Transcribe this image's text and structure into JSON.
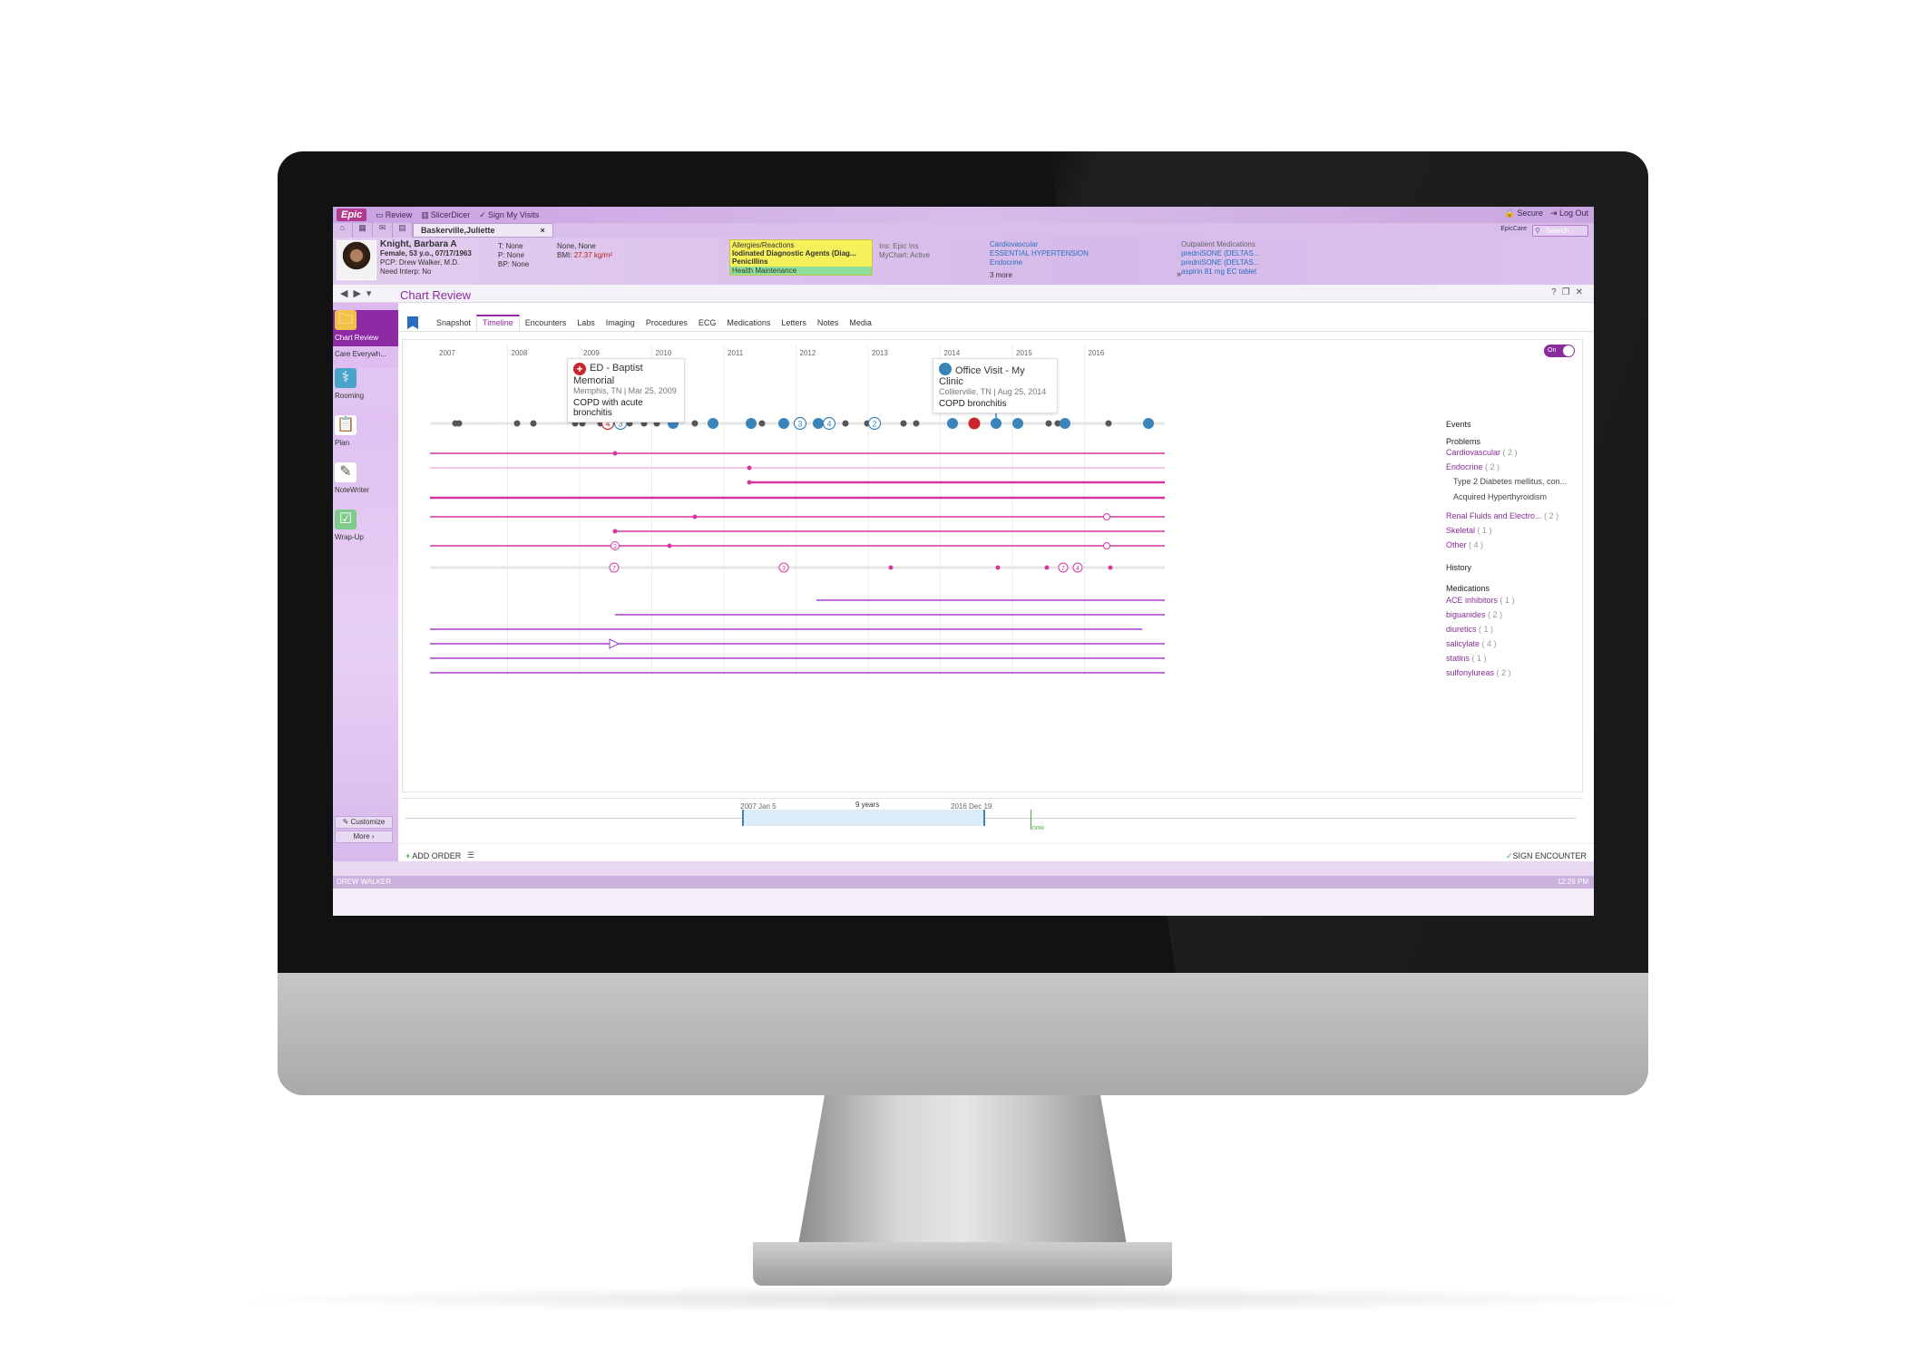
{
  "topbar": {
    "logo": "Epic",
    "items": [
      "Review",
      "SlicerDicer",
      "Sign My Visits"
    ],
    "right": [
      "Secure",
      "Log Out"
    ],
    "search_placeholder": "Search",
    "epiccare": "EpicCare"
  },
  "patient_tab": "Baskerville,Juliette",
  "patient": {
    "name": "Knight, Barbara A",
    "demographics": "Female, 53 y.o., 07/17/1963",
    "pcp": "PCP: Drew Walker, M.D.",
    "interp": "Need Interp: No",
    "t": "T: None",
    "p": "P: None",
    "bp": "BP: None",
    "wt": "None, None",
    "bmi_label": "BMI:",
    "bmi_value": "27.37 kg/m²",
    "allergies_title": "Allergies/Reactions",
    "allergy1": "Iodinated Diagnostic Agents (Diag...",
    "allergy2": "Penicillins",
    "health_maint": "Health Maintenance",
    "ins": "Ins: Epic Ins",
    "mychart": "MyChart: Active",
    "problems": [
      "Cardiovascular",
      "ESSENTIAL HYPERTENSION",
      "Endocrine"
    ],
    "more": "3 more",
    "outpatient_title": "Outpatient Medications",
    "meds": [
      "predniSONE (DELTAS...",
      "predniSONE (DELTAS...",
      "aspirin 81 mg EC tablet"
    ]
  },
  "page_title": "Chart Review",
  "sidebar": {
    "items": [
      "Chart Review",
      "Care Everywh...",
      "Rooming",
      "Plan",
      "NoteWriter",
      "Wrap-Up"
    ],
    "customize": "Customize",
    "more": "More"
  },
  "subtabs": [
    "Snapshot",
    "Timeline",
    "Encounters",
    "Labs",
    "Imaging",
    "Procedures",
    "ECG",
    "Medications",
    "Letters",
    "Notes",
    "Media"
  ],
  "toggle": "On",
  "timeline": {
    "years": [
      "2007",
      "2008",
      "2009",
      "2010",
      "2011",
      "2012",
      "2013",
      "2014",
      "2015",
      "2016"
    ],
    "popup_ed": {
      "title": "ED - Baptist Memorial",
      "sub": "Memphis, TN | Mar 25, 2009",
      "body": "COPD with acute bronchitis"
    },
    "popup_ov": {
      "title": "Office Visit - My Clinic",
      "sub": "Collierville, TN | Aug 25, 2014",
      "body": "COPD bronchitis"
    },
    "event_badges": [
      "4",
      "3",
      "3",
      "4",
      "2"
    ],
    "history_badges": [
      "7",
      "3",
      "7",
      "4"
    ],
    "problem_badges": [
      "2"
    ],
    "events_label": "Events",
    "problems_label": "Problems",
    "problems": [
      {
        "name": "Cardiovascular",
        "count": "( 2 )"
      },
      {
        "name": "Endocrine",
        "count": "( 2 )"
      },
      {
        "name": "Renal Fluids and Electro...",
        "count": "( 2 )"
      },
      {
        "name": "Skeletal",
        "count": "( 1 )"
      },
      {
        "name": "Other",
        "count": "( 4 )"
      }
    ],
    "endocrine_sub": [
      "Type 2 Diabetes mellitus, con...",
      "Acquired Hyperthyroidism"
    ],
    "history_label": "History",
    "medications_label": "Medications",
    "medications": [
      {
        "name": "ACE inhibitors",
        "count": "( 1 )"
      },
      {
        "name": "biguanides",
        "count": "( 2 )"
      },
      {
        "name": "diuretics",
        "count": "( 1 )"
      },
      {
        "name": "salicylate",
        "count": "( 4 )"
      },
      {
        "name": "statins",
        "count": "( 1 )"
      },
      {
        "name": "sulfonylureas",
        "count": "( 2 )"
      }
    ]
  },
  "range": {
    "start": "2007 Jan 5",
    "span": "9 years",
    "end": "2016 Dec 19",
    "now": "now"
  },
  "actions": {
    "add_order": "ADD ORDER",
    "sign": "SIGN ENCOUNTER"
  },
  "status": {
    "user": "DREW WALKER",
    "time": "12:29 PM"
  },
  "colors": {
    "accent": "#8a2c9b",
    "problem": "#d6379f",
    "medication": "#a23fd0",
    "event_blue": "#3b84b9",
    "ed_red": "#c9252c"
  }
}
